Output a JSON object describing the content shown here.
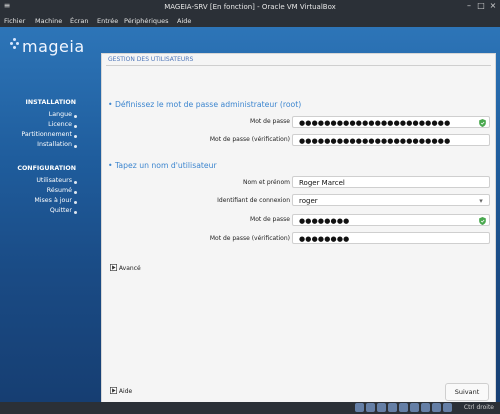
{
  "window": {
    "title": "MAGEIA-SRV [En fonction] - Oracle VM VirtualBox",
    "menu": [
      "Fichier",
      "Machine",
      "Écran",
      "Entrée",
      "Périphériques",
      "Aide"
    ]
  },
  "logo": {
    "text": "mageia"
  },
  "sidebar": {
    "installation_title": "INSTALLATION",
    "installation_items": [
      "Langue",
      "Licence",
      "Partitionnement",
      "Installation"
    ],
    "configuration_title": "CONFIGURATION",
    "configuration_items": [
      "Utilisateurs",
      "Résumé",
      "Mises à jour",
      "Quitter"
    ]
  },
  "panel": {
    "header": "GESTION DES UTILISATEURS",
    "admin_section": "Définissez le mot de passe administrateur (root)",
    "user_section": "Tapez un nom d'utilisateur",
    "labels": {
      "password": "Mot de passe",
      "password_verify": "Mot de passe (vérification)",
      "full_name": "Nom et prénom",
      "login": "Identifiant de connexion"
    },
    "values": {
      "root_password_mask": "●●●●●●●●●●●●●●●●●●●●●●●●",
      "root_password_verify_mask": "●●●●●●●●●●●●●●●●●●●●●●●●",
      "full_name": "Roger Marcel",
      "login": "roger",
      "user_password_mask": "●●●●●●●●",
      "user_password_verify_mask": "●●●●●●●●"
    },
    "advanced": "Avancé",
    "help": "Aide",
    "next": "Suivant"
  },
  "taskbar": {
    "right_text": "Ctrl droite"
  },
  "colors": {
    "accent_blue": "#3d86cf",
    "shield_green": "#49a84e"
  },
  "icons": {
    "shield": "shield-icon",
    "advanced_toggle": "play-toggle-icon",
    "help": "help-toggle-icon",
    "dropdown": "chevron-down-icon"
  }
}
